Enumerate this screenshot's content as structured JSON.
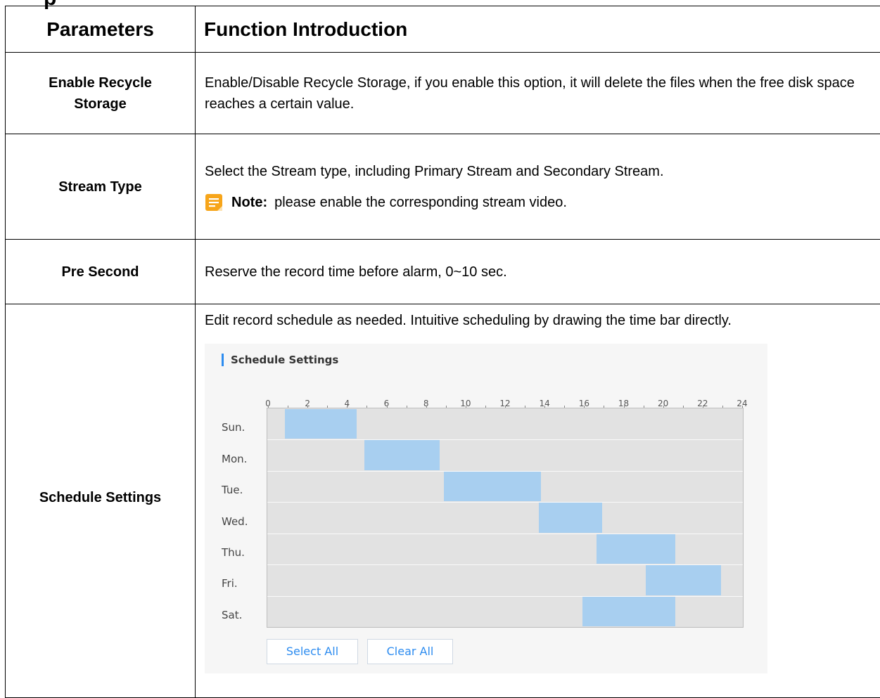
{
  "header": {
    "col1": "Parameters",
    "col2": "Function Introduction"
  },
  "rows": [
    {
      "label": "Enable Recycle Storage",
      "text": "Enable/Disable Recycle Storage, if you enable this option, it will delete the files when the free disk space reaches a certain value."
    },
    {
      "label": "Stream Type",
      "text": "Select the Stream type, including Primary Stream and Secondary Stream.",
      "note_label": "Note:",
      "note_text": "please enable the corresponding stream video.",
      "note_icon": "note-icon"
    },
    {
      "label": "Pre Second",
      "text": "Reserve the record time before alarm, 0~10 sec."
    },
    {
      "label": "Schedule Settings",
      "text": "Edit record schedule as needed. Intuitive scheduling by drawing the time bar directly."
    }
  ],
  "schedule": {
    "title": "Schedule Settings",
    "hours": [
      "0",
      "2",
      "4",
      "6",
      "8",
      "10",
      "12",
      "14",
      "16",
      "18",
      "20",
      "22",
      "24"
    ],
    "days": [
      "Sun.",
      "Mon.",
      "Tue.",
      "Wed.",
      "Thu.",
      "Fri.",
      "Sat."
    ],
    "segments": [
      {
        "day": "Sun.",
        "start": 0.9,
        "end": 4.5
      },
      {
        "day": "Mon.",
        "start": 4.9,
        "end": 8.7
      },
      {
        "day": "Tue.",
        "start": 8.9,
        "end": 13.8
      },
      {
        "day": "Wed.",
        "start": 13.7,
        "end": 16.9
      },
      {
        "day": "Thu.",
        "start": 16.6,
        "end": 20.6
      },
      {
        "day": "Fri.",
        "start": 19.1,
        "end": 22.9
      },
      {
        "day": "Sat.",
        "start": 15.9,
        "end": 20.6
      }
    ],
    "select_all": "Select All",
    "clear_all": "Clear All",
    "bar_color": "#a8cff0",
    "accent_color": "#2d8cf0"
  }
}
